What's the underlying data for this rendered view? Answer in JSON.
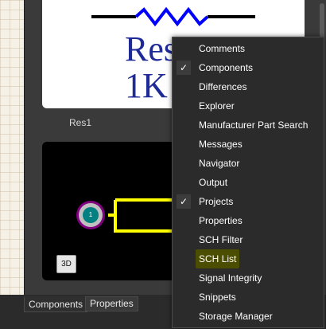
{
  "library_panel": {
    "symbol_text_line1": "Res1",
    "symbol_text_line2": "1K",
    "component_name": "Res1",
    "pad_label": "1",
    "btn_3d_label": "3D"
  },
  "panel_tabs": [
    {
      "label": "Components",
      "active": true
    },
    {
      "label": "Properties",
      "active": false
    }
  ],
  "context_menu": {
    "items": [
      {
        "label": "Comments",
        "checked": false
      },
      {
        "label": "Components",
        "checked": true
      },
      {
        "label": "Differences",
        "checked": false
      },
      {
        "label": "Explorer",
        "checked": false
      },
      {
        "label": "Manufacturer Part Search",
        "checked": false
      },
      {
        "label": "Messages",
        "checked": false
      },
      {
        "label": "Navigator",
        "checked": false
      },
      {
        "label": "Output",
        "checked": false
      },
      {
        "label": "Projects",
        "checked": true
      },
      {
        "label": "Properties",
        "checked": false
      },
      {
        "label": "SCH Filter",
        "checked": false
      },
      {
        "label": "SCH List",
        "checked": false,
        "highlighted": true
      },
      {
        "label": "Signal Integrity",
        "checked": false
      },
      {
        "label": "Snippets",
        "checked": false
      },
      {
        "label": "Storage Manager",
        "checked": false
      }
    ],
    "check_glyph": "✓"
  },
  "colors": {
    "resistor_blue": "#0000ff",
    "symbol_text": "#1f2a99",
    "footprint_outline": "#ffff00",
    "pad_ring": "#800080",
    "pad_center": "#008080",
    "highlight": "#4b4d00"
  }
}
